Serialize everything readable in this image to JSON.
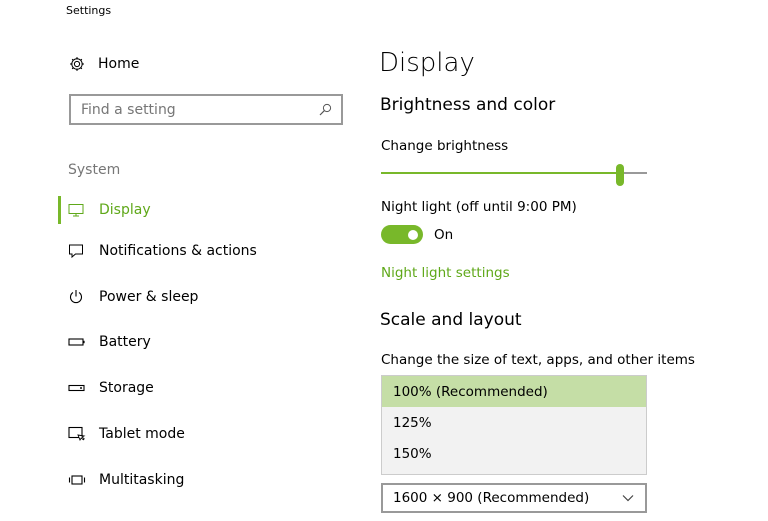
{
  "window": {
    "title": "Settings"
  },
  "sidebar": {
    "home_label": "Home",
    "search_placeholder": "Find a setting",
    "section_label": "System",
    "items": [
      {
        "label": "Display",
        "icon": "monitor-icon",
        "active": true
      },
      {
        "label": "Notifications & actions",
        "icon": "notification-icon"
      },
      {
        "label": "Power & sleep",
        "icon": "power-icon"
      },
      {
        "label": "Battery",
        "icon": "battery-icon"
      },
      {
        "label": "Storage",
        "icon": "storage-icon"
      },
      {
        "label": "Tablet mode",
        "icon": "tablet-mode-icon"
      },
      {
        "label": "Multitasking",
        "icon": "multitasking-icon"
      }
    ]
  },
  "main": {
    "title": "Display",
    "brightness": {
      "heading": "Brightness and color",
      "label": "Change brightness",
      "value_percent": 90
    },
    "night_light": {
      "label": "Night light (off until 9:00 PM)",
      "state": "On",
      "settings_link": "Night light settings"
    },
    "scale": {
      "heading": "Scale and layout",
      "label": "Change the size of text, apps, and other items",
      "options": [
        "100% (Recommended)",
        "125%",
        "150%"
      ],
      "selected_index": 0
    },
    "resolution": {
      "value": "1600 × 900 (Recommended)"
    }
  },
  "colors": {
    "accent": "#78b82a",
    "accent_text": "#5fa819",
    "selected_bg": "#c5dea6"
  }
}
